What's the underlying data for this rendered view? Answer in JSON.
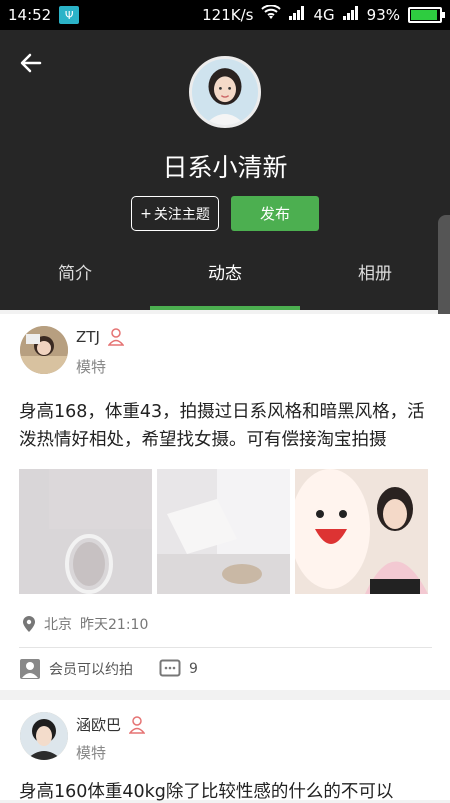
{
  "status_bar": {
    "time": "14:52",
    "speed": "121K/s",
    "network": "4G",
    "battery": "93%",
    "battery_level": 0.93
  },
  "header": {
    "title": "日系小清新",
    "follow_label": "关注主题",
    "follow_plus": "+",
    "publish_label": "发布"
  },
  "tabs": [
    {
      "label": "简介",
      "active": false
    },
    {
      "label": "动态",
      "active": true
    },
    {
      "label": "相册",
      "active": false
    }
  ],
  "posts": [
    {
      "username": "ZTJ",
      "role": "模特",
      "text": "身高168，体重43，拍摄过日系风格和暗黑风格，活泼热情好相处，希望找女摄。可有偿接淘宝拍摄",
      "location": "北京",
      "time": "昨天21:10",
      "booking_label": "会员可以约拍",
      "comment_count": "9"
    },
    {
      "username": "涵欧巴",
      "role": "模特",
      "text": "身高160体重40kg除了比较性感的什么的不可以"
    }
  ],
  "colors": {
    "accent": "#4caf50",
    "header_bg": "#262626",
    "gender_icon": "#e57373"
  },
  "icons": {
    "back": "arrow-left-icon",
    "location": "location-pin-icon",
    "member": "person-card-icon",
    "comment": "comment-icon",
    "gender": "female-user-icon"
  }
}
